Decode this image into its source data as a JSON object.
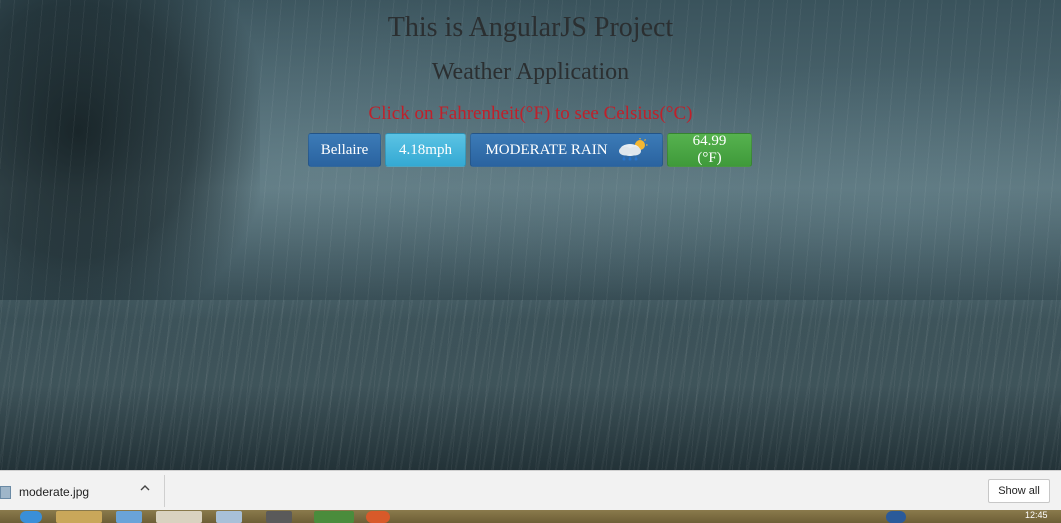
{
  "header": {
    "title": "This is AngularJS Project",
    "subtitle": "Weather Application",
    "hint": "Click on Fahrenheit(°F) to see Celsius(°C)"
  },
  "weather": {
    "city": "Bellaire",
    "wind": "4.18mph",
    "condition": "MODERATE RAIN",
    "condition_icon": "rain-cloud-icon",
    "temperature": "64.99 (°F)"
  },
  "colors": {
    "hint": "#c0202a",
    "primary": "#2a63a0",
    "info": "#34a9d3",
    "success": "#3f9a3a"
  },
  "download_bar": {
    "file_name": "moderate.jpg",
    "show_all_label": "Show all"
  },
  "taskbar": {
    "clock": "12:45"
  }
}
